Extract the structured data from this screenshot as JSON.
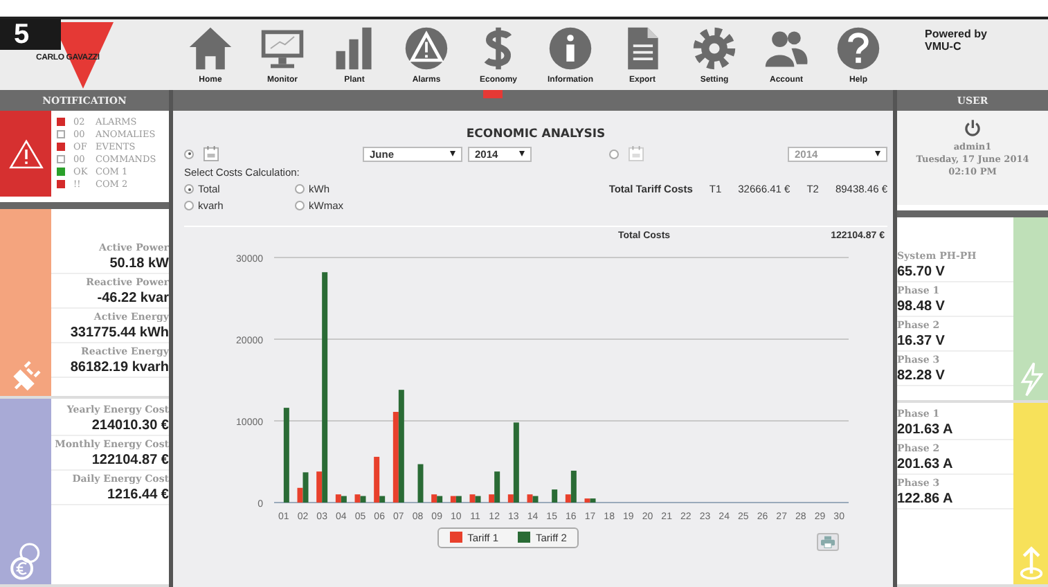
{
  "badge": "5",
  "logo": "CARLO GAVAZZI",
  "nav": [
    {
      "label": "Home",
      "kind": "home"
    },
    {
      "label": "Monitor",
      "kind": "monitor"
    },
    {
      "label": "Plant",
      "kind": "plant"
    },
    {
      "label": "Alarms",
      "kind": "alarms"
    },
    {
      "label": "Economy",
      "kind": "economy"
    },
    {
      "label": "Information",
      "kind": "information"
    },
    {
      "label": "Export",
      "kind": "export"
    },
    {
      "label": "Setting",
      "kind": "setting"
    },
    {
      "label": "Account",
      "kind": "account"
    },
    {
      "label": "Help",
      "kind": "help"
    }
  ],
  "powered_by": [
    "Powered by",
    "VMU-C"
  ],
  "notification": {
    "title": "NOTIFICATION",
    "items": [
      {
        "code": "02",
        "label": "ALARMS",
        "kind": "alarm"
      },
      {
        "code": "00",
        "label": "ANOMALIES",
        "kind": "empty"
      },
      {
        "code": "OF",
        "label": "EVENTS",
        "kind": "alarm"
      },
      {
        "code": "00",
        "label": "COMMANDS",
        "kind": "empty"
      },
      {
        "code": "OK",
        "label": "COM 1",
        "kind": "ok"
      },
      {
        "code": "!!",
        "label": "COM 2",
        "kind": "alarm"
      }
    ]
  },
  "user": {
    "title": "USER",
    "name": "admin1",
    "date": "Tuesday, 17 June 2014",
    "time": "02:10 PM"
  },
  "power": [
    {
      "label": "Active Power",
      "value": "50.18 kW"
    },
    {
      "label": "Reactive Power",
      "value": "-46.22 kvar"
    },
    {
      "label": "Active Energy",
      "value": "331775.44 kWh"
    },
    {
      "label": "Reactive Energy",
      "value": "86182.19 kvarh"
    }
  ],
  "costs": [
    {
      "label": "Yearly Energy Cost",
      "value": "214010.30 €"
    },
    {
      "label": "Monthly Energy Cost",
      "value": "122104.87 €"
    },
    {
      "label": "Daily Energy Cost",
      "value": "1216.44 €"
    }
  ],
  "voltages": [
    {
      "label": "System PH-PH",
      "value": "65.70 V"
    },
    {
      "label": "Phase 1",
      "value": "98.48 V"
    },
    {
      "label": "Phase 2",
      "value": "16.37 V"
    },
    {
      "label": "Phase 3",
      "value": "82.28 V"
    }
  ],
  "currents": [
    {
      "label": "Phase 1",
      "value": "201.63 A"
    },
    {
      "label": "Phase 2",
      "value": "201.63 A"
    },
    {
      "label": "Phase 3",
      "value": "122.86 A"
    }
  ],
  "analysis": {
    "title": "ECONOMIC ANALYSIS",
    "monthly": {
      "selected": true,
      "month": "June",
      "year": "2014"
    },
    "yearly": {
      "selected": false,
      "year": "2014"
    },
    "calc_label": "Select Costs Calculation:",
    "calc_options": [
      {
        "label": "Total",
        "selected": true
      },
      {
        "label": "kWh",
        "selected": false
      },
      {
        "label": "kvarh",
        "selected": false
      },
      {
        "label": "kWmax",
        "selected": false
      }
    ],
    "tariff_costs": {
      "label": "Total Tariff Costs",
      "t1_label": "T1",
      "t1": "32666.41 €",
      "t2_label": "T2",
      "t2": "89438.46 €"
    },
    "total_costs": {
      "label": "Total Costs",
      "value": "122104.87 €"
    },
    "chart_data": {
      "type": "bar",
      "categories": [
        "01",
        "02",
        "03",
        "04",
        "05",
        "06",
        "07",
        "08",
        "09",
        "10",
        "11",
        "12",
        "13",
        "14",
        "15",
        "16",
        "17",
        "18",
        "19",
        "20",
        "21",
        "22",
        "23",
        "24",
        "25",
        "26",
        "27",
        "28",
        "29",
        "30"
      ],
      "series": [
        {
          "name": "Tariff 1",
          "color": "#e8402c",
          "values": [
            0,
            1800,
            3800,
            1000,
            1000,
            5600,
            11100,
            0,
            1000,
            800,
            1000,
            1000,
            1000,
            1000,
            0,
            1000,
            500,
            0,
            0,
            0,
            0,
            0,
            0,
            0,
            0,
            0,
            0,
            0,
            0,
            0
          ]
        },
        {
          "name": "Tariff 2",
          "color": "#2a6b35",
          "values": [
            11600,
            3700,
            28200,
            800,
            800,
            800,
            13800,
            4700,
            800,
            800,
            800,
            3800,
            9800,
            800,
            1600,
            3900,
            500,
            0,
            0,
            0,
            0,
            0,
            0,
            0,
            0,
            0,
            0,
            0,
            0,
            0
          ]
        }
      ],
      "ylim": [
        0,
        30000
      ],
      "yticks": [
        0,
        10000,
        20000,
        30000
      ],
      "legend": "bottom"
    }
  }
}
